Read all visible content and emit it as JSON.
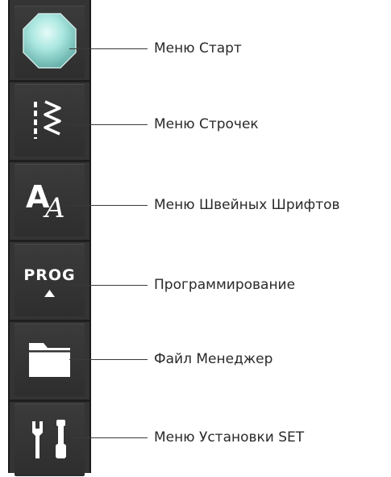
{
  "toolbar": {
    "items": [
      {
        "id": "start",
        "label": "Меню Старт",
        "icon": "start-octagon-icon"
      },
      {
        "id": "stitches",
        "label": "Меню Строчек",
        "icon": "stitch-icon"
      },
      {
        "id": "fonts",
        "label": "Меню Швейных Шрифтов",
        "icon": "font-icon"
      },
      {
        "id": "prog",
        "label": "Программирование",
        "icon": "prog-icon",
        "button_text": "PROG"
      },
      {
        "id": "files",
        "label": "Файл Менеджер",
        "icon": "folder-icon"
      },
      {
        "id": "settings",
        "label": "Меню Установки SET",
        "icon": "tools-icon"
      }
    ]
  },
  "colors": {
    "toolbar_bg": "#343434",
    "start_button": "#8fd8d2",
    "icon": "#ffffff",
    "callout_line": "#3a3a3a",
    "label_text": "#2a2a2a"
  }
}
